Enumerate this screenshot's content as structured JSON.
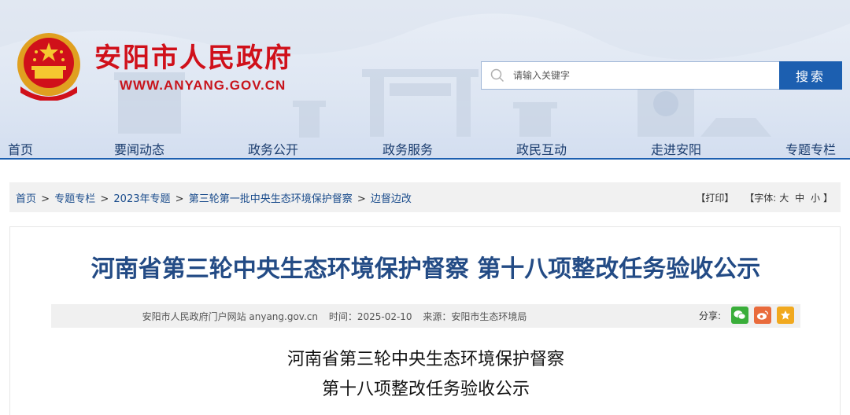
{
  "site": {
    "title": "安阳市人民政府",
    "url": "WWW.ANYANG.GOV.CN"
  },
  "search": {
    "placeholder": "请输入关键字",
    "button_label": "搜索"
  },
  "nav": {
    "items": [
      "首页",
      "要闻动态",
      "政务公开",
      "政务服务",
      "政民互动",
      "走进安阳",
      "专题专栏"
    ]
  },
  "breadcrumb": {
    "items": [
      "首页",
      "专题专栏",
      "2023年专题",
      "第三轮第一批中央生态环境保护督察",
      "边督边改"
    ],
    "separator": ">"
  },
  "tools": {
    "print": "【打印】",
    "font_label": "【字体:",
    "font_large": "大",
    "font_medium": "中",
    "font_small": "小",
    "font_close": "】"
  },
  "article": {
    "title": "河南省第三轮中央生态环境保护督察 第十八项整改任务验收公示",
    "meta": {
      "source_site": "安阳市人民政府门户网站 anyang.gov.cn",
      "time": "时间：2025-02-10",
      "origin": "来源：安阳市生态环境局"
    },
    "share_label": "分享:",
    "body_title_line1": "河南省第三轮中央生态环境保护督察",
    "body_title_line2": "第十八项整改任务验收公示"
  },
  "colors": {
    "brand_red": "#d0101a",
    "nav_blue": "#1c5fb0",
    "title_blue": "#234b85"
  }
}
